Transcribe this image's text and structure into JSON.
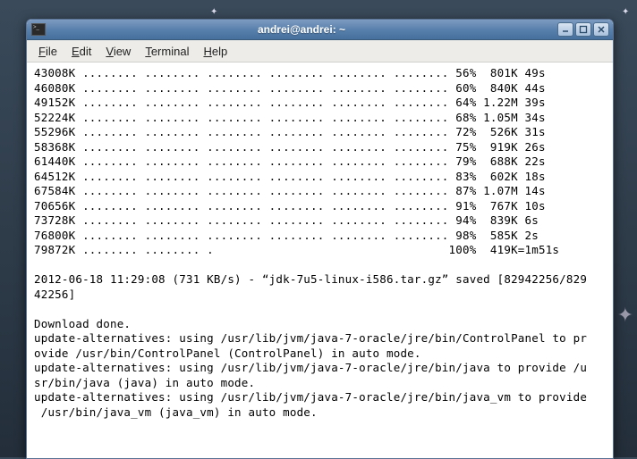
{
  "titlebar": {
    "title": "andrei@andrei: ~",
    "icon_prompt": ">_",
    "minimize_button": "minimize",
    "maximize_button": "maximize",
    "close_button": "close"
  },
  "menubar": {
    "file": "File",
    "edit": "Edit",
    "view": "View",
    "terminal": "Terminal",
    "help": "Help"
  },
  "progress_rows": [
    {
      "size": "43008K",
      "dots": "........ ........ ........ ........ ........ ........",
      "pct": "56%",
      "rate": "801K",
      "eta": "49s"
    },
    {
      "size": "46080K",
      "dots": "........ ........ ........ ........ ........ ........",
      "pct": "60%",
      "rate": "840K",
      "eta": "44s"
    },
    {
      "size": "49152K",
      "dots": "........ ........ ........ ........ ........ ........",
      "pct": "64%",
      "rate": "1.22M",
      "eta": "39s"
    },
    {
      "size": "52224K",
      "dots": "........ ........ ........ ........ ........ ........",
      "pct": "68%",
      "rate": "1.05M",
      "eta": "34s"
    },
    {
      "size": "55296K",
      "dots": "........ ........ ........ ........ ........ ........",
      "pct": "72%",
      "rate": "526K",
      "eta": "31s"
    },
    {
      "size": "58368K",
      "dots": "........ ........ ........ ........ ........ ........",
      "pct": "75%",
      "rate": "919K",
      "eta": "26s"
    },
    {
      "size": "61440K",
      "dots": "........ ........ ........ ........ ........ ........",
      "pct": "79%",
      "rate": "688K",
      "eta": "22s"
    },
    {
      "size": "64512K",
      "dots": "........ ........ ........ ........ ........ ........",
      "pct": "83%",
      "rate": "602K",
      "eta": "18s"
    },
    {
      "size": "67584K",
      "dots": "........ ........ ........ ........ ........ ........",
      "pct": "87%",
      "rate": "1.07M",
      "eta": "14s"
    },
    {
      "size": "70656K",
      "dots": "........ ........ ........ ........ ........ ........",
      "pct": "91%",
      "rate": "767K",
      "eta": "10s"
    },
    {
      "size": "73728K",
      "dots": "........ ........ ........ ........ ........ ........",
      "pct": "94%",
      "rate": "839K",
      "eta": "6s"
    },
    {
      "size": "76800K",
      "dots": "........ ........ ........ ........ ........ ........",
      "pct": "98%",
      "rate": "585K",
      "eta": "2s"
    },
    {
      "size": "79872K",
      "dots": "........ ........ .",
      "pct": "100%",
      "rate": "419K=1m51s",
      "eta": ""
    }
  ],
  "summary_line1": "2012-06-18 11:29:08 (731 KB/s) - “jdk-7u5-linux-i586.tar.gz” saved [82942256/829",
  "summary_line2": "42256]",
  "download_done": "Download done.",
  "alt1a": "update-alternatives: using /usr/lib/jvm/java-7-oracle/jre/bin/ControlPanel to pr",
  "alt1b": "ovide /usr/bin/ControlPanel (ControlPanel) in auto mode.",
  "alt2a": "update-alternatives: using /usr/lib/jvm/java-7-oracle/jre/bin/java to provide /u",
  "alt2b": "sr/bin/java (java) in auto mode.",
  "alt3a": "update-alternatives: using /usr/lib/jvm/java-7-oracle/jre/bin/java_vm to provide",
  "alt3b": " /usr/bin/java_vm (java_vm) in auto mode."
}
